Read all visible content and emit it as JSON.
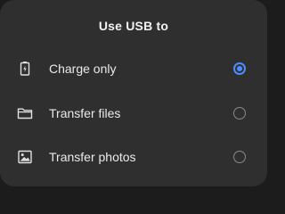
{
  "dialog": {
    "title": "Use USB to",
    "options": [
      {
        "label": "Charge only",
        "icon": "battery-charging-icon",
        "selected": true
      },
      {
        "label": "Transfer files",
        "icon": "folder-icon",
        "selected": false
      },
      {
        "label": "Transfer photos",
        "icon": "image-icon",
        "selected": false
      }
    ]
  },
  "colors": {
    "background": "#2f2f2f",
    "text": "#eaeaea",
    "accent": "#4c8dff",
    "radio_unselected": "#8a8a8a"
  }
}
